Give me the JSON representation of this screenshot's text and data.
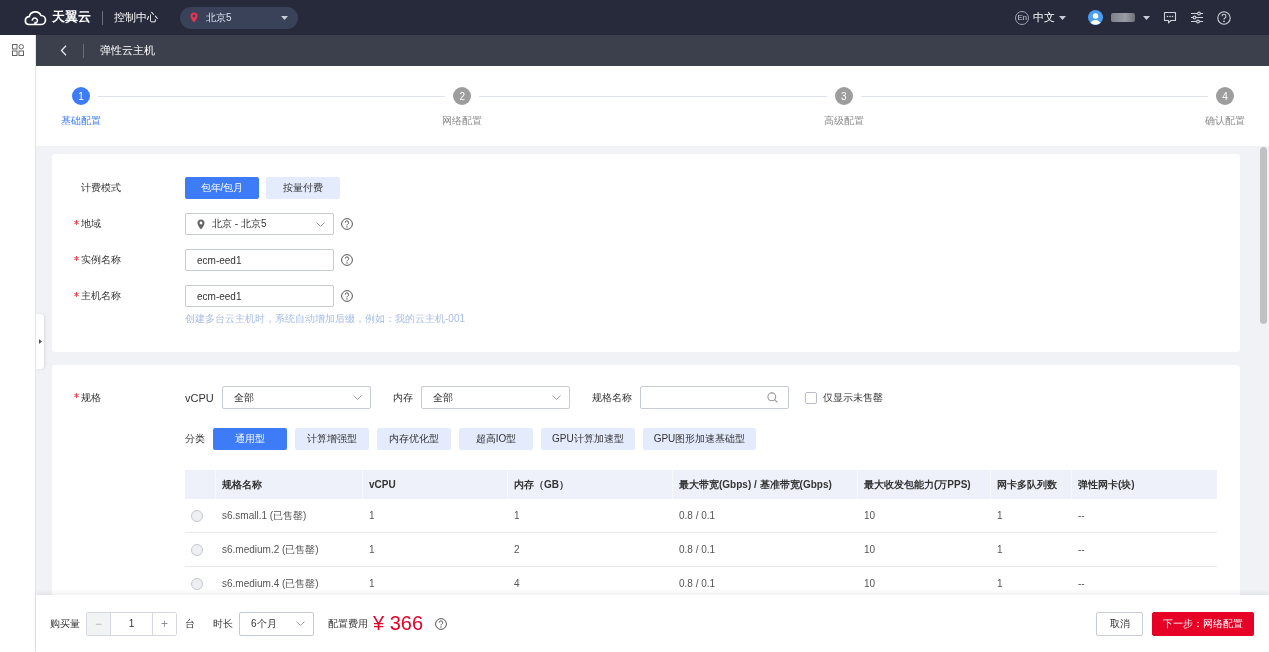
{
  "top_bar": {
    "brand": "天翼云",
    "console": "控制中心",
    "region": "北京5",
    "language_icon": "En",
    "language": "中文"
  },
  "page_header": {
    "title": "弹性云主机"
  },
  "steps": [
    {
      "number": "1",
      "label": "基础配置",
      "selected": true
    },
    {
      "number": "2",
      "label": "网络配置",
      "selected": false
    },
    {
      "number": "3",
      "label": "高级配置",
      "selected": false
    },
    {
      "number": "4",
      "label": "确认配置",
      "selected": false
    }
  ],
  "basic_config": {
    "fields": [
      {
        "kind": "segmented",
        "label": "计费模式",
        "required": false,
        "help": false,
        "options": [
          {
            "label": "包年/包月",
            "selected": true
          },
          {
            "label": "按量付费",
            "selected": false
          }
        ]
      },
      {
        "kind": "region_select",
        "label": "地域",
        "required": true,
        "help": true,
        "value": "北京 - 北京5"
      },
      {
        "kind": "input",
        "label": "实例名称",
        "required": true,
        "help": true,
        "value": "ecm-eed1"
      },
      {
        "kind": "input",
        "label": "主机名称",
        "required": true,
        "help": true,
        "value": "ecm-eed1",
        "hint": "创建多台云主机时，系统自动增加后缀，例如：我的云主机-001"
      }
    ]
  },
  "spec": {
    "label": "规格",
    "required": true,
    "filters": [
      {
        "kind": "select",
        "label": "vCPU",
        "value": "全部"
      },
      {
        "kind": "select",
        "label": "内存",
        "value": "全部"
      },
      {
        "kind": "search",
        "label": "规格名称"
      }
    ],
    "available_only": {
      "label": "仅显示未售罄",
      "checked": false
    },
    "category_label": "分类",
    "categories": [
      {
        "label": "通用型",
        "selected": true
      },
      {
        "label": "计算增强型",
        "selected": false
      },
      {
        "label": "内存优化型",
        "selected": false
      },
      {
        "label": "超高IO型",
        "selected": false
      },
      {
        "label": "GPU计算加速型",
        "selected": false
      },
      {
        "label": "GPU图形加速基础型",
        "selected": false
      }
    ],
    "table": {
      "columns": [
        "规格名称",
        "vCPU",
        "内存（GB）",
        "最大带宽(Gbps) / 基准带宽(Gbps)",
        "最大收发包能力(万PPS)",
        "网卡多队列数",
        "弹性网卡(块)"
      ],
      "rows": [
        {
          "selected": false,
          "disabled": true,
          "cells": [
            "s6.small.1 (已售罄)",
            "1",
            "1",
            "0.8 / 0.1",
            "10",
            "1",
            "--"
          ]
        },
        {
          "selected": false,
          "disabled": true,
          "cells": [
            "s6.medium.2 (已售罄)",
            "1",
            "2",
            "0.8 / 0.1",
            "10",
            "1",
            "--"
          ]
        },
        {
          "selected": false,
          "disabled": true,
          "cells": [
            "s6.medium.4 (已售罄)",
            "1",
            "4",
            "0.8 / 0.1",
            "10",
            "1",
            "--"
          ]
        }
      ]
    }
  },
  "footer": {
    "quantity": {
      "label": "购买量",
      "decrement": {
        "symbol": "−",
        "disabled": true
      },
      "value": "1",
      "increment": {
        "symbol": "+",
        "disabled": false
      },
      "unit": "台"
    },
    "duration": {
      "label": "时长",
      "value": "6个月"
    },
    "cost": {
      "label": "配置费用",
      "value": "¥ 366"
    },
    "buttons": [
      {
        "label": "取消",
        "kind": "secondary"
      },
      {
        "label": "下一步：网络配置",
        "kind": "primary"
      }
    ]
  }
}
